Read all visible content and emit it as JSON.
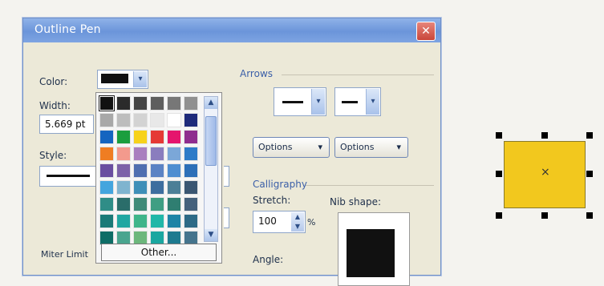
{
  "dialog": {
    "title": "Outline Pen",
    "close_icon": "close-icon",
    "color_label": "Color:",
    "width_label": "Width:",
    "width_value": "5.669 pt",
    "style_label": "Style:",
    "miter_label": "Miter Limit",
    "arrows_label": "Arrows",
    "options_left": "Options",
    "options_right": "Options",
    "calligraphy_label": "Calligraphy",
    "stretch_label": "Stretch:",
    "stretch_value": "100",
    "stretch_unit": "%",
    "nib_shape_label": "Nib shape:",
    "angle_label": "Angle:"
  },
  "palette": {
    "other_label": "Other...",
    "swatches": [
      "#111111",
      "#2b2b2b",
      "#454545",
      "#5e5e5e",
      "#777777",
      "#909090",
      "#a8a8a8",
      "#bdbdbd",
      "#d3d3d3",
      "#e8e8e8",
      "#ffffff",
      "#1e2a7a",
      "#1565c0",
      "#1b9e3e",
      "#f7d21a",
      "#e53935",
      "#e5156d",
      "#8e2d8f",
      "#ef7d22",
      "#f39a8d",
      "#a97fbf",
      "#8a7dbe",
      "#7ba7d8",
      "#2d7bc8",
      "#6a4ea0",
      "#7c62a8",
      "#4f6fb0",
      "#5b83c4",
      "#4e8ed1",
      "#2c6fb8",
      "#44a5de",
      "#7fb4cf",
      "#3f8fb8",
      "#3d6e9f",
      "#4c7f97",
      "#3a5672",
      "#2f8d87",
      "#2a6d6a",
      "#3f8a78",
      "#3f9e83",
      "#2f7e71",
      "#44617c",
      "#1a7a78",
      "#21a7a2",
      "#3fb58a",
      "#21b7a8",
      "#1e84a6",
      "#2d6a86",
      "#0e6d66",
      "#4aa58f",
      "#6cb77c",
      "#1aa7a0",
      "#1e7a8f",
      "#45748d"
    ]
  },
  "canvas": {
    "selection_marker": "×",
    "fill_color": "#f2c81e"
  }
}
